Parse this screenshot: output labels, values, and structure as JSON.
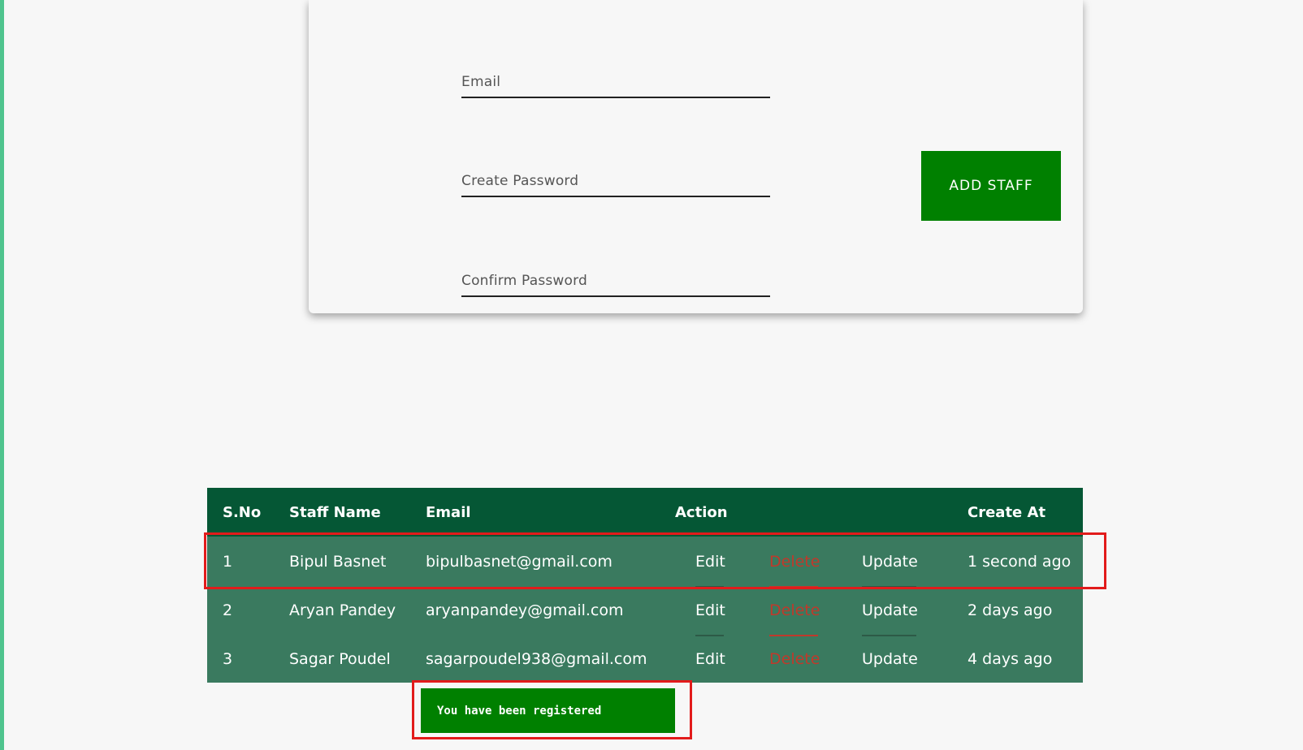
{
  "form": {
    "email_placeholder": "Email",
    "password_placeholder": "Create Password",
    "confirm_placeholder": "Confirm Password",
    "add_label": "ADD STAFF"
  },
  "table": {
    "headers": {
      "sno": "S.No",
      "name": "Staff Name",
      "email": "Email",
      "action": "Action",
      "created": "Create At"
    },
    "rows": [
      {
        "sno": "1",
        "name": "Bipul Basnet",
        "email": "bipulbasnet@gmail.com",
        "edit": "Edit",
        "delete": "Delete",
        "update": "Update",
        "created": "1 second ago"
      },
      {
        "sno": "2",
        "name": "Aryan Pandey",
        "email": "aryanpandey@gmail.com",
        "edit": "Edit",
        "delete": "Delete",
        "update": "Update",
        "created": "2 days ago"
      },
      {
        "sno": "3",
        "name": "Sagar Poudel",
        "email": "sagarpoudel938@gmail.com",
        "edit": "Edit",
        "delete": "Delete",
        "update": "Update",
        "created": "4 days ago"
      }
    ]
  },
  "toast": {
    "message": "You have been registered"
  },
  "colors": {
    "accent_green": "#008000",
    "table_header": "#055735",
    "table_body": "#3a7a5f",
    "delete_red": "#c0392b",
    "highlight_red": "#e21b1b",
    "left_strip": "#4fc48e"
  }
}
